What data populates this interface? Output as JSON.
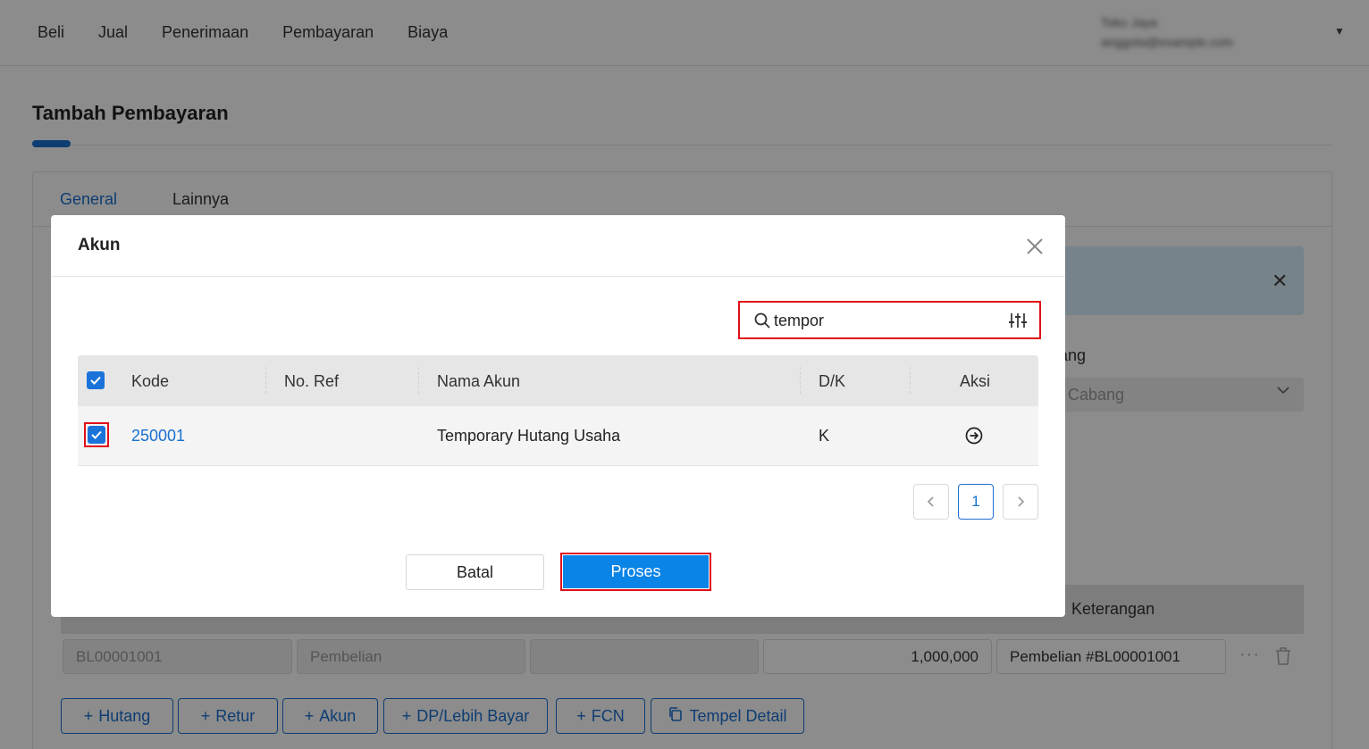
{
  "topnav": {
    "menu": [
      "Beli",
      "Jual",
      "Penerimaan",
      "Pembayaran",
      "Biaya"
    ],
    "user_name": "Toko Jaya",
    "user_email": "anggota@example.com"
  },
  "page": {
    "title": "Tambah Pembayaran",
    "tabs": [
      "General",
      "Lainnya"
    ],
    "branch_label": "ang",
    "branch_placeholder": "h Cabang",
    "table_header_keterangan": "Keterangan",
    "row": {
      "ref": "BL00001001",
      "type": "Pembelian",
      "empty": "",
      "amount": "1,000,000",
      "note": "Pembelian #BL00001001"
    },
    "add_buttons": [
      "Hutang",
      "Retur",
      "Akun",
      "DP/Lebih Bayar",
      "FCN"
    ],
    "paste_button": "Tempel Detail"
  },
  "modal": {
    "title": "Akun",
    "search": {
      "value": "tempor",
      "placeholder": ""
    },
    "columns": {
      "kode": "Kode",
      "no_ref": "No. Ref",
      "nama_akun": "Nama Akun",
      "dk": "D/K",
      "aksi": "Aksi"
    },
    "rows": [
      {
        "kode": "250001",
        "no_ref": "",
        "nama_akun": "Temporary Hutang Usaha",
        "dk": "K",
        "checked": true
      }
    ],
    "pagination": {
      "current_page": "1"
    },
    "cancel_label": "Batal",
    "submit_label": "Proses"
  },
  "colors": {
    "primary": "#1a6fd0",
    "submit": "#0a84e6",
    "highlight": "#e0101a"
  },
  "icons": {
    "search": "search-icon",
    "filter": "sliders-icon",
    "close": "close-icon",
    "action": "arrow-right-circle-icon",
    "add": "plus-icon",
    "paste": "copy-icon",
    "delete": "trash-icon"
  }
}
